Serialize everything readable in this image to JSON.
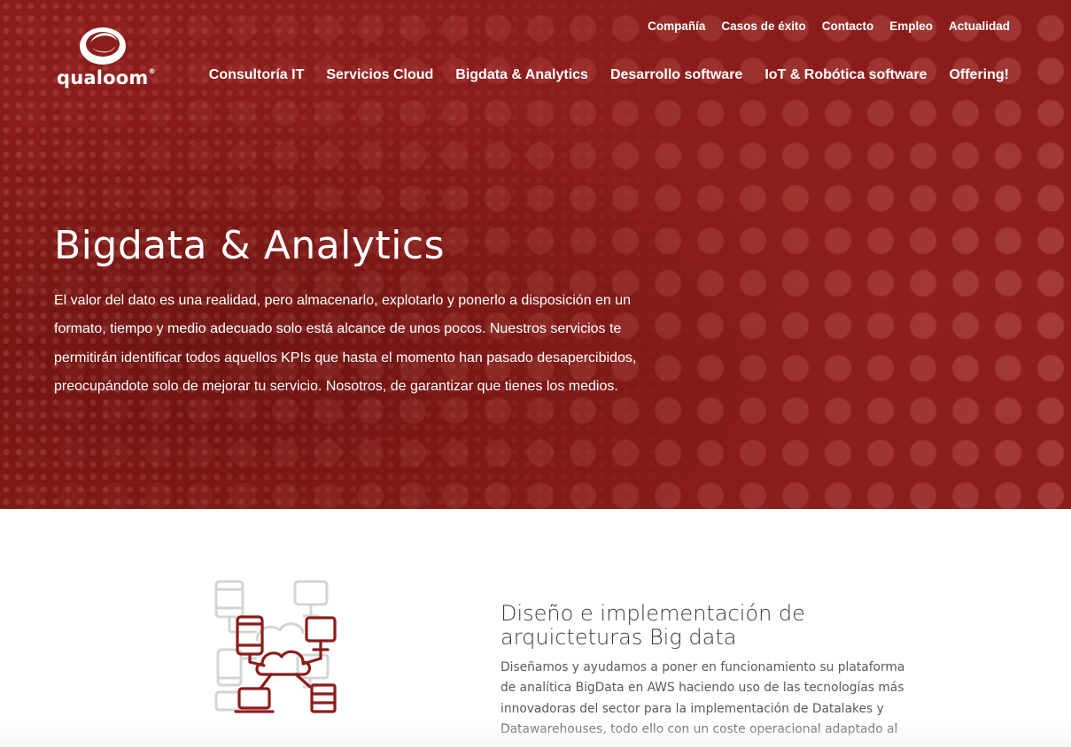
{
  "brand": {
    "name": "qualoom",
    "reg_mark": "®"
  },
  "colors": {
    "primary": "#8b1d1b",
    "white": "#ffffff",
    "text_dark": "#3a3a3a",
    "icon_gray": "#d4d4d4"
  },
  "top_nav": [
    {
      "label": "Compañía"
    },
    {
      "label": "Casos de éxito"
    },
    {
      "label": "Contacto"
    },
    {
      "label": "Empleo"
    },
    {
      "label": "Actualidad"
    }
  ],
  "main_nav": [
    {
      "label": "Consultoría IT"
    },
    {
      "label": "Servicios Cloud"
    },
    {
      "label": "Bigdata & Analytics"
    },
    {
      "label": "Desarrollo software"
    },
    {
      "label": "IoT & Robótica software"
    },
    {
      "label": "Offering!"
    }
  ],
  "hero": {
    "title": "Bigdata & Analytics",
    "text": "El valor del dato es una realidad, pero almacenarlo, explotarlo y ponerlo a disposición en un formato, tiempo y medio adecuado solo está alcance de unos pocos. Nuestros servicios te permitirán identificar todos aquellos KPIs que hasta el momento han pasado desapercibidos, preocupándote solo de mejorar tu servicio. Nosotros, de garantizar que tienes los medios."
  },
  "feature": {
    "icon": "cloud-network-icon",
    "title": "Diseño e implementación de arquicteturas Big data",
    "text": "Diseñamos y ayudamos a poner en funcionamiento su plataforma de analítica BigData en AWS haciendo uso de las tecnologías más innovadoras del sector para la implementación de Datalakes y Datawarehouses, todo ello con un coste operacional adaptado al"
  }
}
